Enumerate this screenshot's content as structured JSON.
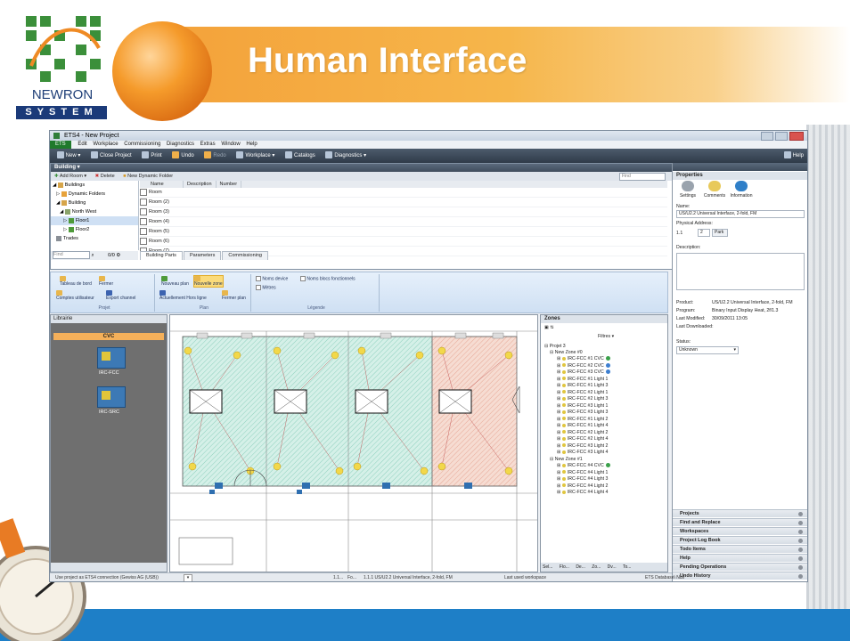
{
  "slide": {
    "title": "Human Interface",
    "logo_name": "NEWRON",
    "logo_system": "SYSTEM"
  },
  "app": {
    "window_title": "ETS4 - New Project",
    "menu": [
      "ETS",
      "Edit",
      "Workplace",
      "Commissioning",
      "Diagnostics",
      "Extras",
      "Window",
      "Help"
    ],
    "toolbar": [
      "New ▾",
      "Close Project",
      "Print",
      "Undo",
      "Redo",
      "Workplace ▾",
      "Catalogs",
      "Diagnostics ▾"
    ],
    "help": "Help",
    "building_panel": {
      "title": "Building ▾",
      "actions": [
        "Add Room ▾",
        "Delete",
        "New Dynamic Folder"
      ],
      "find_placeholder": "Find",
      "tree": [
        "Buildings",
        "Dynamic Folders",
        "Building",
        "North West",
        "Floor1",
        "Floor2",
        "Trades"
      ],
      "tree_find": "Find",
      "tree_count": "0/0",
      "columns": [
        "Name",
        "Description",
        "Number"
      ],
      "rows": [
        "Room",
        "Room (2)",
        "Room (3)",
        "Room (4)",
        "Room (5)",
        "Room (6)",
        "Room (7)"
      ],
      "tabs": [
        "Building Parts",
        "Parameters",
        "Commissioning"
      ]
    },
    "ribbon": {
      "group1": {
        "items": [
          "Tableau de bord",
          "Fermer",
          "Comptes utilisateur",
          "Export channel"
        ],
        "label": "Projet"
      },
      "group2": {
        "items": [
          "Nouveau plan",
          "Nouvelle zone",
          "Actuellement Hors ligne",
          "Fermer plan"
        ],
        "label": "Plan"
      },
      "group3": {
        "items": [
          "Noms device",
          "Noms blocs fonctionnels",
          "Mètres"
        ],
        "label": "Légende"
      }
    },
    "librarie": {
      "title": "Librairie",
      "category": "CVC",
      "devices": [
        "IRC-FCC",
        "IRC-SRC"
      ]
    },
    "zones": {
      "title": "Zones",
      "filter": "Filtres",
      "project": "Projet 3",
      "zone0": "New Zone #0",
      "zone0_items": [
        "IRC-FCC #1 CVC",
        "IRC-FCC #2 CVC",
        "IRC-FCC #3 CVC",
        "IRC-FCC #1 Light 1",
        "IRC-FCC #1 Light 3",
        "IRC-FCC #2 Light 1",
        "IRC-FCC #2 Light 3",
        "IRC-FCC #3 Light 1",
        "IRC-FCC #3 Light 3",
        "IRC-FCC #1 Light 2",
        "IRC-FCC #1 Light 4",
        "IRC-FCC #2 Light 2",
        "IRC-FCC #2 Light 4",
        "IRC-FCC #3 Light 2",
        "IRC-FCC #3 Light 4"
      ],
      "zone1": "New Zone #1",
      "zone1_items": [
        "IRC-FCC #4 CVC",
        "IRC-FCC #4 Light 1",
        "IRC-FCC #4 Light 3",
        "IRC-FCC #4 Light 2",
        "IRC-FCC #4 Light 4"
      ],
      "bottom_tabs": [
        "Sel...",
        "Flo...",
        "De...",
        "Zo...",
        "Dv...",
        "To..."
      ]
    },
    "properties": {
      "title": "Properties",
      "tabs": [
        "Settings",
        "Comments",
        "Information"
      ],
      "name_label": "Name:",
      "name_value": "US/U2.2 Universal Interface, 2-fold, FM",
      "phys_label": "Physical Address:",
      "phys_a": "1.1",
      "phys_b": "2",
      "park": "Park",
      "desc_label": "Description:",
      "product_label": "Product:",
      "product_value": "US/U2.2 Universal Interface, 2-fold, FM",
      "program_label": "Program:",
      "program_value": "Binary Input Display Heat, 2f/1.3",
      "modified_label": "Last Modified:",
      "modified_value": "30/09/2011 13:05",
      "downloaded_label": "Last Downloaded:",
      "status_label": "Status:",
      "status_value": "Unknown"
    },
    "side_sections": [
      "Projects",
      "Find and Replace",
      "Workspaces",
      "Project Log Book",
      "Todo Items",
      "Help",
      "Pending Operations",
      "Undo History"
    ],
    "statusbar": {
      "s1": "Use project as ETS4 connection (Gewiss AG (USB))",
      "s2": "1.1...",
      "s3": "Fo...",
      "s4": "1.1.1 US/U2.2 Universal Interface, 2-fold, FM",
      "s5": "Last used workspace",
      "s6": "ETS Database\\ Null"
    }
  }
}
